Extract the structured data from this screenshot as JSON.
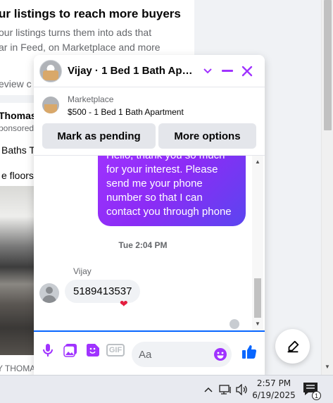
{
  "feed": {
    "title": "ur listings to reach more buyers",
    "line1": "our listings turns them into ads that",
    "line2": "ar in Feed, on Marketplace and more",
    "line3": "eview c"
  },
  "post": {
    "author": "Thomas",
    "sponsored": "ponsored",
    "text1": "Baths T",
    "text2": "e floors",
    "footer": "Y THOMA"
  },
  "chat": {
    "title": "Vijay · 1 Bed 1 Bath Apart...",
    "listing": {
      "source": "Marketplace",
      "name": "$500 - 1 Bed 1 Bath Apartment"
    },
    "actions": {
      "pending_label": "Mark as pending",
      "more_label": "More options"
    },
    "outgoing_message": "Hello, thank you so much for your interest. Please send me your phone number so that I can contact you through phone",
    "timestamp": "Tue 2:04 PM",
    "sender_name": "Vijay",
    "incoming_message": "5189413537",
    "reaction": "❤",
    "composer": {
      "placeholder": "Aa"
    }
  },
  "colors": {
    "messenger_accent": "#a033ff",
    "link_blue": "#0866ff",
    "like_blue": "#0866ff"
  },
  "taskbar": {
    "time": "2:57 PM",
    "date": "6/19/2025",
    "notification_count": "1"
  }
}
